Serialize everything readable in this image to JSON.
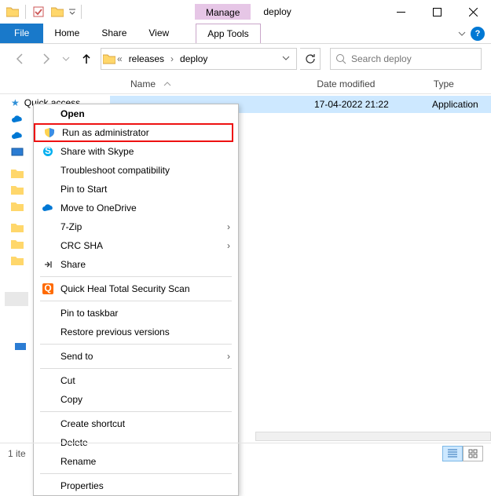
{
  "window": {
    "manage": "Manage",
    "title": "deploy"
  },
  "tabs": {
    "file": "File",
    "home": "Home",
    "share": "Share",
    "view": "View",
    "app_tools": "App Tools"
  },
  "breadcrumb": {
    "seg1": "releases",
    "seg2": "deploy"
  },
  "search": {
    "placeholder": "Search deploy"
  },
  "columns": {
    "name": "Name",
    "date": "Date modified",
    "type": "Type"
  },
  "row": {
    "date": "17-04-2022 21:22",
    "type": "Application"
  },
  "nav": {
    "quick": "Quick access"
  },
  "menu": {
    "open": "Open",
    "run_admin": "Run as administrator",
    "share_skype": "Share with Skype",
    "troubleshoot": "Troubleshoot compatibility",
    "pin_start": "Pin to Start",
    "onedrive": "Move to OneDrive",
    "sevenzip": "7-Zip",
    "crc": "CRC SHA",
    "share": "Share",
    "quickheal": "Quick Heal Total Security Scan",
    "pin_taskbar": "Pin to taskbar",
    "restore": "Restore previous versions",
    "sendto": "Send to",
    "cut": "Cut",
    "copy": "Copy",
    "shortcut": "Create shortcut",
    "delete": "Delete",
    "rename": "Rename",
    "properties": "Properties"
  },
  "status": {
    "items": "1 ite"
  }
}
